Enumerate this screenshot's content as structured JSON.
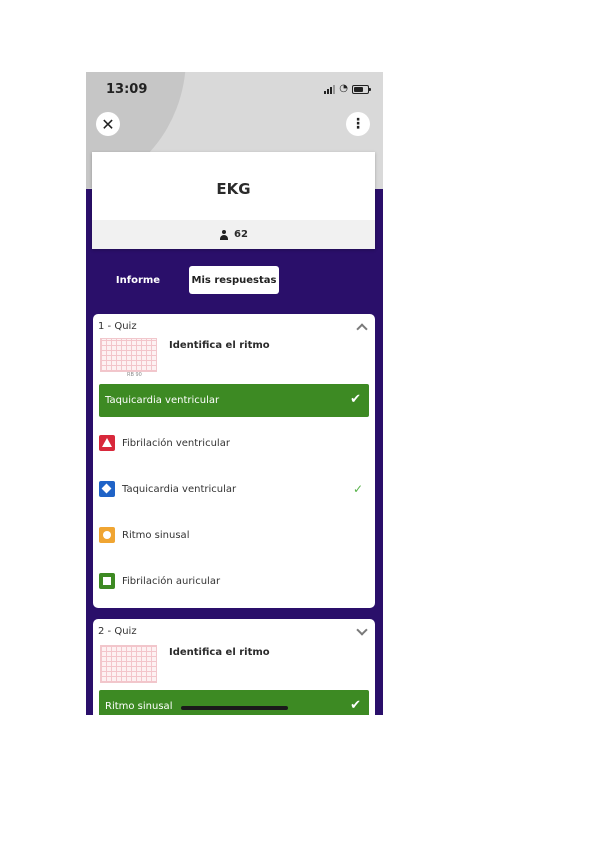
{
  "status_bar": {
    "time": "13:09"
  },
  "header": {
    "title": "EKG",
    "participants": "62"
  },
  "tabs": [
    {
      "label": "Informe"
    },
    {
      "label": "Mis respuestas"
    }
  ],
  "quizzes": [
    {
      "number": "1 - Quiz",
      "question": "Identifica el ritmo",
      "thumb_caption": "RB  90",
      "selected_answer": "Taquicardia ventricular",
      "options": [
        {
          "label": "Fibrilación ventricular",
          "icon": "triangle-icon",
          "color": "#d8283b"
        },
        {
          "label": "Taquicardia ventricular",
          "icon": "diamond-icon",
          "color": "#1f63c7",
          "correct": true
        },
        {
          "label": "Ritmo sinusal",
          "icon": "circle-icon",
          "color": "#f0a532"
        },
        {
          "label": "Fibrilación auricular",
          "icon": "square-icon",
          "color": "#3d8a23"
        }
      ]
    },
    {
      "number": "2 - Quiz",
      "question": "Identifica el ritmo",
      "selected_answer": "Ritmo sinusal"
    }
  ],
  "colors": {
    "header_purple": "#2a0f6a",
    "correct_green": "#3d8a23"
  }
}
